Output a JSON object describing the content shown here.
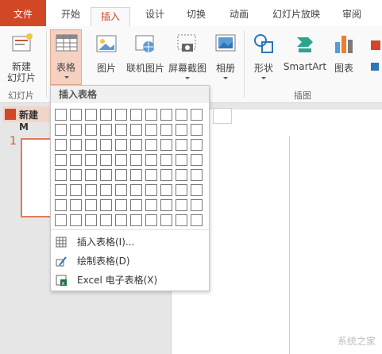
{
  "tabs": [
    {
      "label": "文件"
    },
    {
      "label": "开始"
    },
    {
      "label": "插入"
    },
    {
      "label": "设计"
    },
    {
      "label": "切换"
    },
    {
      "label": "动画"
    },
    {
      "label": "幻灯片放映"
    },
    {
      "label": "审阅"
    }
  ],
  "ribbon": {
    "new_slide": "新建\n幻灯片",
    "table": "表格",
    "picture": "图片",
    "online_picture": "联机图片",
    "screenshot": "屏幕截图",
    "album": "相册",
    "shapes": "形状",
    "smartart": "SmartArt",
    "chart": "图表",
    "group_slides": "幻灯片",
    "group_illustrations": "插图"
  },
  "panel": {
    "tab_label": "新建 M"
  },
  "slides": [
    {
      "number": "1"
    }
  ],
  "insert_table_popup": {
    "title": "插入表格",
    "grid_cols": 10,
    "grid_rows": 8,
    "items": [
      {
        "label": "插入表格(I)...",
        "icon": "table-icon"
      },
      {
        "label": "绘制表格(D)",
        "icon": "pencil-table-icon"
      },
      {
        "label": "Excel 电子表格(X)",
        "icon": "excel-icon"
      }
    ]
  },
  "watermark": "系统之家"
}
